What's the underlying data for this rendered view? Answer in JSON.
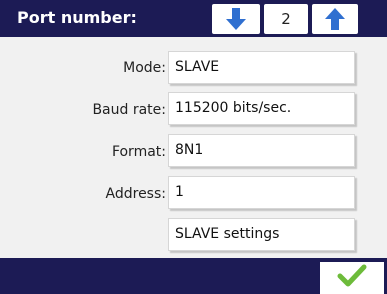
{
  "header": {
    "port_label": "Port number:",
    "port_value": "2"
  },
  "rows": [
    {
      "label": "Mode:",
      "value": "SLAVE"
    },
    {
      "label": "Baud rate:",
      "value": "115200  bits/sec."
    },
    {
      "label": "Format:",
      "value": "8N1"
    },
    {
      "label": "Address:",
      "value": "1"
    }
  ],
  "slave_settings_label": "SLAVE settings",
  "colors": {
    "header_bg": "#1c1b55",
    "arrow_blue": "#2f6fd0",
    "confirm_green": "#6dbb3a"
  },
  "icons": {
    "down": "arrow-down-icon",
    "up": "arrow-up-icon",
    "confirm": "checkmark-icon"
  }
}
